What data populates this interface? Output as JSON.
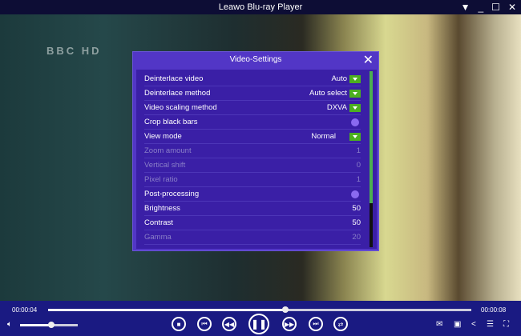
{
  "window": {
    "title": "Leawo Blu-ray Player"
  },
  "video": {
    "channel_logo": "BBC HD"
  },
  "dialog": {
    "title": "Video-Settings",
    "rows": [
      {
        "label": "Deinterlace video",
        "value": "Auto",
        "control": "dropdown",
        "enabled": true
      },
      {
        "label": "Deinterlace method",
        "value": "Auto select",
        "control": "dropdown",
        "enabled": true
      },
      {
        "label": "Video scaling method",
        "value": "DXVA",
        "control": "dropdown",
        "enabled": true
      },
      {
        "label": "Crop black bars",
        "value": "",
        "control": "toggle",
        "enabled": true
      },
      {
        "label": "View mode",
        "value": "Normal",
        "control": "dropdown",
        "enabled": true
      },
      {
        "label": "Zoom amount",
        "value": "1",
        "control": "number",
        "enabled": false
      },
      {
        "label": "Vertical shift",
        "value": "0",
        "control": "number",
        "enabled": false
      },
      {
        "label": "Pixel ratio",
        "value": "1",
        "control": "number",
        "enabled": false
      },
      {
        "label": "Post-processing",
        "value": "",
        "control": "toggle",
        "enabled": true
      },
      {
        "label": "Brightness",
        "value": "50",
        "control": "number",
        "enabled": true
      },
      {
        "label": "Contrast",
        "value": "50",
        "control": "number",
        "enabled": true
      },
      {
        "label": "Gamma",
        "value": "20",
        "control": "number",
        "enabled": false
      }
    ]
  },
  "player": {
    "current_time": "00:00:04",
    "total_time": "00:00:08",
    "progress_percent": 56,
    "volume_percent": 50
  }
}
